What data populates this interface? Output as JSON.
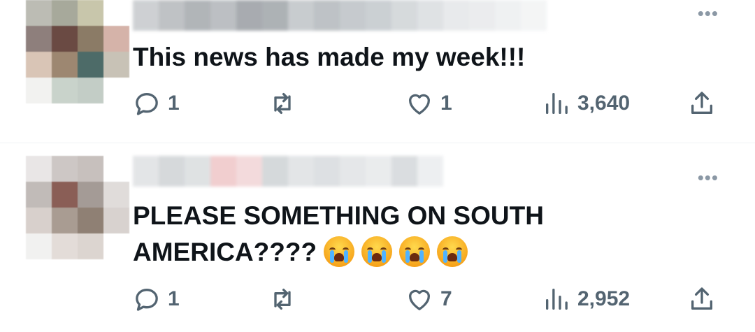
{
  "tweets": [
    {
      "text": "This news has made my week!!!",
      "more_label": "•••",
      "emojis": [],
      "reply_count": "1",
      "retweet_count": "",
      "like_count": "1",
      "view_count": "3,640"
    },
    {
      "text": "PLEASE SOMETHING ON SOUTH AMERICA????",
      "more_label": "•••",
      "emojis": [
        "loudly-crying-face",
        "loudly-crying-face",
        "loudly-crying-face",
        "loudly-crying-face"
      ],
      "reply_count": "1",
      "retweet_count": "",
      "like_count": "7",
      "view_count": "2,952"
    }
  ],
  "colors": {
    "text": "#0f1419",
    "icon": "#536471",
    "divider": "#eff3f4"
  }
}
